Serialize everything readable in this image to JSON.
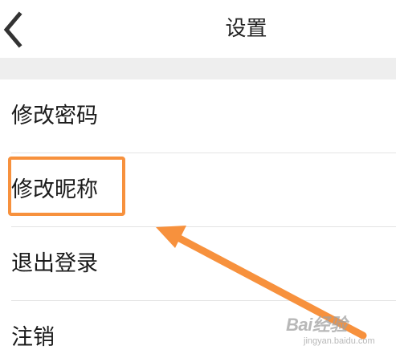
{
  "header": {
    "title": "设置",
    "back_icon": "chevron-left-icon"
  },
  "menu": {
    "items": [
      {
        "label": "修改密码"
      },
      {
        "label": "修改昵称"
      },
      {
        "label": "退出登录"
      },
      {
        "label": "注销"
      }
    ]
  },
  "annotation": {
    "highlight_color": "#f7913d",
    "highlighted_item": "修改昵称"
  },
  "watermark": {
    "brand": "Bai经验",
    "sub": "jingyan.baidu.com"
  }
}
